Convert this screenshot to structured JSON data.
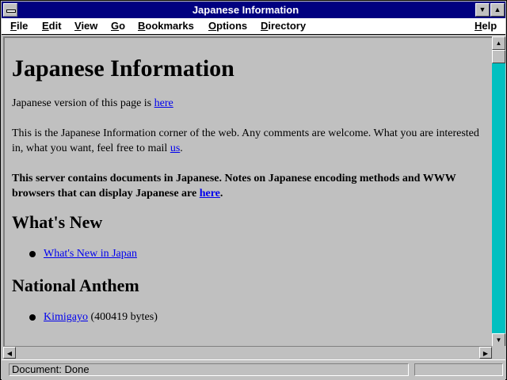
{
  "window": {
    "title": "Japanese Information"
  },
  "menu": [
    {
      "label": "File",
      "accel": "F",
      "rest": "ile"
    },
    {
      "label": "Edit",
      "accel": "E",
      "rest": "dit"
    },
    {
      "label": "View",
      "accel": "V",
      "rest": "iew"
    },
    {
      "label": "Go",
      "accel": "G",
      "rest": "o"
    },
    {
      "label": "Bookmarks",
      "accel": "B",
      "rest": "ookmarks"
    },
    {
      "label": "Options",
      "accel": "O",
      "rest": "ptions"
    },
    {
      "label": "Directory",
      "accel": "D",
      "rest": "irectory"
    },
    {
      "label": "Help",
      "accel": "H",
      "rest": "elp"
    }
  ],
  "page": {
    "heading": "Japanese Information",
    "japanese_version": {
      "text": "Japanese version of this page is ",
      "link": "here"
    },
    "intro": {
      "text": "This is the Japanese Information corner of the web. Any comments are welcome. What you are interested in, what you want, feel free to mail ",
      "link": "us",
      "end": "."
    },
    "notice": {
      "text": "This server contains documents in Japanese. Notes on Japanese encoding methods and WWW browsers that can display Japanese are ",
      "link": "here",
      "end": "."
    },
    "whats_new": {
      "heading": "What's New",
      "items": [
        {
          "link": "What's New in Japan"
        }
      ]
    },
    "anthem": {
      "heading": "National Anthem",
      "items": [
        {
          "link": "Kimigayo",
          "suffix": " (400419 bytes)"
        }
      ]
    }
  },
  "status": {
    "text": "Document: Done"
  },
  "icons": {
    "system_menu": "system-menu-icon",
    "minimize": "minimize-icon",
    "maximize": "maximize-icon",
    "scroll_up": "arrow-up-icon",
    "scroll_down": "arrow-down-icon",
    "scroll_left": "arrow-left-icon",
    "scroll_right": "arrow-right-icon",
    "bullet": "bullet-icon"
  },
  "colors": {
    "titlebar": "#000080",
    "link": "#0000ee",
    "scroll_track": "#00c0c0",
    "background": "#c0c0c0"
  }
}
